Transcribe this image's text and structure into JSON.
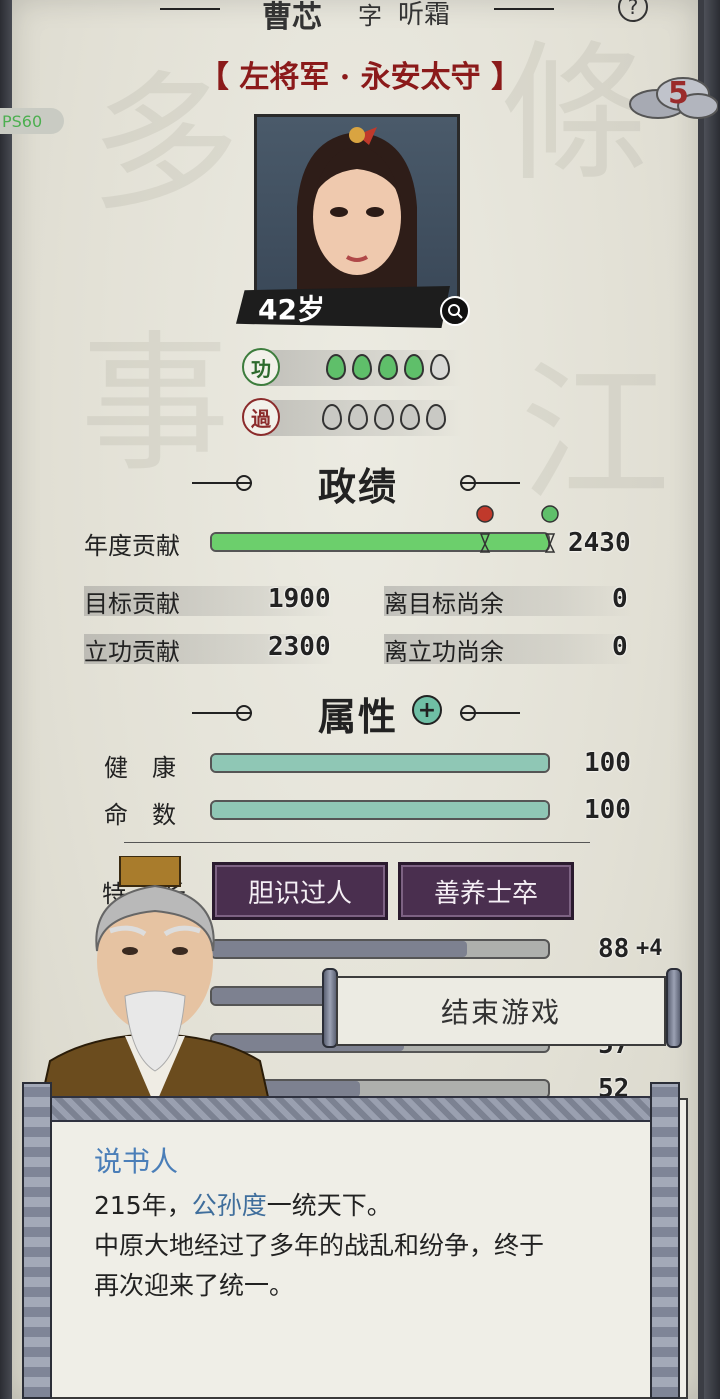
{
  "header": {
    "name": "曹芯",
    "courtesy_label": "字",
    "courtesy_name": "听霜",
    "help_icon": "question-icon"
  },
  "titles": "【 左将军 · 永安太守 】",
  "cloud_badge": {
    "value": "5"
  },
  "fps_tag": "PS60",
  "portrait": {
    "age": "42岁",
    "search_icon": "search-icon"
  },
  "merit": {
    "label": "功",
    "filled": 4,
    "total": 5
  },
  "fault": {
    "label": "過",
    "filled": 0,
    "total": 5
  },
  "zhengji": {
    "title": "政绩",
    "annual": {
      "label": "年度贡献",
      "value": "2430",
      "fill": 1.0,
      "marker_red": 0.81,
      "marker_green": 1.0
    },
    "target": {
      "label": "目标贡献",
      "value": "1900"
    },
    "to_target": {
      "label": "离目标尚余",
      "value": "0"
    },
    "merit_contrib": {
      "label": "立功贡献",
      "value": "2300"
    },
    "to_merit": {
      "label": "离立功尚余",
      "value": "0"
    }
  },
  "attributes": {
    "title": "属性",
    "add_icon": "plus-circle-icon",
    "health": {
      "label": "健　康",
      "value": "100",
      "fill": 1.0
    },
    "fate": {
      "label": "命　数",
      "value": "100",
      "fill": 1.0
    }
  },
  "traits": {
    "label": "特长",
    "items": [
      "胆识过人",
      "善养士卒"
    ]
  },
  "stats": [
    {
      "value": "88",
      "bonus": "+4",
      "fill": 0.76
    },
    {
      "value": "",
      "bonus": "",
      "fill": 0.5
    },
    {
      "value": "57",
      "bonus": "",
      "fill": 0.57
    },
    {
      "value": "52",
      "bonus": "",
      "fill": 0.44
    }
  ],
  "end_game_button": "结束游戏",
  "dialog": {
    "speaker": "说书人",
    "line1_prefix": "215年，",
    "line1_name": "公孙度",
    "line1_suffix": "一统天下。",
    "line2": "中原大地经过了多年的战乱和纷争，终于",
    "line3": "再次迎来了统一。"
  },
  "colors": {
    "contribution_bar": "#6ccf6c",
    "attribute_bar": "#8fc7b5",
    "trait_button": "#4a2f4f",
    "highlight_name": "#3f6e9c",
    "merit_pip": "#5fbf6a",
    "fault_pip": "#8c8c8c"
  }
}
